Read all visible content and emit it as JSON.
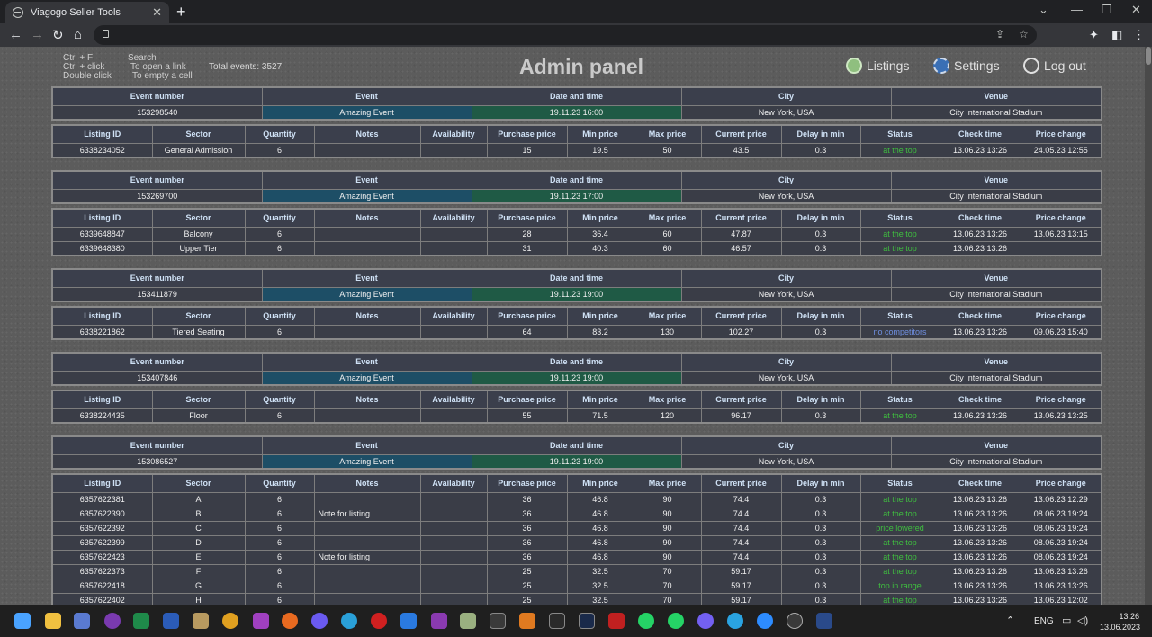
{
  "browser": {
    "tab_title": "Viagogo Seller Tools",
    "tab_close": "✕",
    "new_tab": "+"
  },
  "header": {
    "hints_keys": [
      "Ctrl + F",
      "Ctrl + click",
      "Double click"
    ],
    "hints_actions": [
      "Search",
      "To open a link",
      "To empty a cell"
    ],
    "total_events": "Total events: 3527",
    "title": "Admin panel",
    "nav": {
      "listings": "Listings",
      "settings": "Settings",
      "logout": "Log out"
    }
  },
  "event_headers": [
    "Event number",
    "Event",
    "Date and time",
    "City",
    "Venue"
  ],
  "listing_headers": [
    "Listing ID",
    "Sector",
    "Quantity",
    "Notes",
    "Availability",
    "Purchase price",
    "Min price",
    "Max price",
    "Current price",
    "Delay in min",
    "Status",
    "Check time",
    "Price change"
  ],
  "status_colors": {
    "at the top": "#3fbf3f",
    "price lowered": "#3fbf3f",
    "top in range": "#3fbf3f",
    "no competitors": "#6f8fe0"
  },
  "events": [
    {
      "number": "153298540",
      "name": "Amazing Event",
      "datetime": "19.11.23 16:00",
      "city": "New York, USA",
      "venue": "City International Stadium",
      "listings": [
        [
          "6338234052",
          "General Admission",
          "6",
          "",
          "",
          "15",
          "19.5",
          "50",
          "43.5",
          "0.3",
          "at the top",
          "13.06.23 13:26",
          "24.05.23 12:55"
        ]
      ]
    },
    {
      "number": "153269700",
      "name": "Amazing Event",
      "datetime": "19.11.23 17:00",
      "city": "New York, USA",
      "venue": "City International Stadium",
      "listings": [
        [
          "6339648847",
          "Balcony",
          "6",
          "",
          "",
          "28",
          "36.4",
          "60",
          "47.87",
          "0.3",
          "at the top",
          "13.06.23 13:26",
          "13.06.23 13:15"
        ],
        [
          "6339648380",
          "Upper Tier",
          "6",
          "",
          "",
          "31",
          "40.3",
          "60",
          "46.57",
          "0.3",
          "at the top",
          "13.06.23 13:26",
          ""
        ]
      ]
    },
    {
      "number": "153411879",
      "name": "Amazing Event",
      "datetime": "19.11.23 19:00",
      "city": "New York, USA",
      "venue": "City International Stadium",
      "listings": [
        [
          "6338221862",
          "Tiered Seating",
          "6",
          "",
          "",
          "64",
          "83.2",
          "130",
          "102.27",
          "0.3",
          "no competitors",
          "13.06.23 13:26",
          "09.06.23 15:40"
        ]
      ]
    },
    {
      "number": "153407846",
      "name": "Amazing Event",
      "datetime": "19.11.23 19:00",
      "city": "New York, USA",
      "venue": "City International Stadium",
      "listings": [
        [
          "6338224435",
          "Floor",
          "6",
          "",
          "",
          "55",
          "71.5",
          "120",
          "96.17",
          "0.3",
          "at the top",
          "13.06.23 13:26",
          "13.06.23 13:25"
        ]
      ]
    },
    {
      "number": "153086527",
      "name": "Amazing Event",
      "datetime": "19.11.23 19:00",
      "city": "New York, USA",
      "venue": "City International Stadium",
      "listings": [
        [
          "6357622381",
          "A",
          "6",
          "",
          "",
          "36",
          "46.8",
          "90",
          "74.4",
          "0.3",
          "at the top",
          "13.06.23 13:26",
          "13.06.23 12:29"
        ],
        [
          "6357622390",
          "B",
          "6",
          "Note for listing",
          "",
          "36",
          "46.8",
          "90",
          "74.4",
          "0.3",
          "at the top",
          "13.06.23 13:26",
          "08.06.23 19:24"
        ],
        [
          "6357622392",
          "C",
          "6",
          "",
          "",
          "36",
          "46.8",
          "90",
          "74.4",
          "0.3",
          "price lowered",
          "13.06.23 13:26",
          "08.06.23 19:24"
        ],
        [
          "6357622399",
          "D",
          "6",
          "",
          "",
          "36",
          "46.8",
          "90",
          "74.4",
          "0.3",
          "at the top",
          "13.06.23 13:26",
          "08.06.23 19:24"
        ],
        [
          "6357622423",
          "E",
          "6",
          "Note for listing",
          "",
          "36",
          "46.8",
          "90",
          "74.4",
          "0.3",
          "at the top",
          "13.06.23 13:26",
          "08.06.23 19:24"
        ],
        [
          "6357622373",
          "F",
          "6",
          "",
          "",
          "25",
          "32.5",
          "70",
          "59.17",
          "0.3",
          "at the top",
          "13.06.23 13:26",
          "13.06.23 13:26"
        ],
        [
          "6357622418",
          "G",
          "6",
          "",
          "",
          "25",
          "32.5",
          "70",
          "59.17",
          "0.3",
          "top in range",
          "13.06.23 13:26",
          "13.06.23 13:26"
        ],
        [
          "6357622402",
          "H",
          "6",
          "",
          "",
          "25",
          "32.5",
          "70",
          "59.17",
          "0.3",
          "at the top",
          "13.06.23 13:26",
          "13.06.23 12:02"
        ]
      ]
    }
  ],
  "taskbar": {
    "lang": "ENG",
    "time": "13:26",
    "date": "13.06.2023"
  }
}
